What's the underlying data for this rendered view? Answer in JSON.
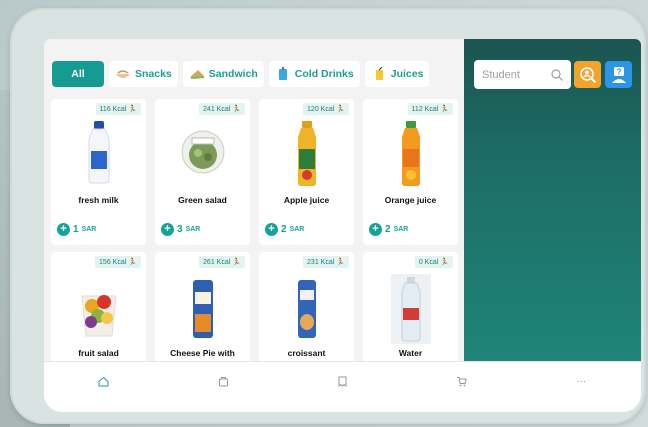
{
  "colors": {
    "accent": "#169b92",
    "panel": "#1d6b64",
    "orange": "#f1a32a",
    "blue": "#2d95e6"
  },
  "categories": [
    {
      "label": "All",
      "icon": "all",
      "active": true
    },
    {
      "label": "Snacks",
      "icon": "snacks-icon"
    },
    {
      "label": "Sandwich",
      "icon": "sandwich-icon"
    },
    {
      "label": "Cold Drinks",
      "icon": "cold-drink-icon"
    },
    {
      "label": "Juices",
      "icon": "juice-icon"
    }
  ],
  "search": {
    "placeholder": "Student"
  },
  "products": [
    {
      "name": "fresh milk",
      "kcal": "116 Kcal",
      "price": "1",
      "currency": "SAR",
      "image": "milk-bottle"
    },
    {
      "name": "Green salad",
      "kcal": "241 Kcal",
      "price": "3",
      "currency": "SAR",
      "image": "salad-bowl"
    },
    {
      "name": "Apple juice",
      "kcal": "120 Kcal",
      "price": "2",
      "currency": "SAR",
      "image": "apple-juice-bottle"
    },
    {
      "name": "Orange juice",
      "kcal": "112 Kcal",
      "price": "2",
      "currency": "SAR",
      "image": "orange-juice-bottle"
    },
    {
      "name": "fruit salad",
      "kcal": "156 Kcal",
      "image": "fruit-cup"
    },
    {
      "name": "Cheese Pie with",
      "kcal": "261 Kcal",
      "image": "pie-pack"
    },
    {
      "name": "croissant",
      "kcal": "231 Kcal",
      "image": "croissant-pack"
    },
    {
      "name": "Water",
      "kcal": "0 Kcal",
      "image": "water-bottle"
    }
  ],
  "nav": [
    {
      "icon": "home-icon"
    },
    {
      "icon": "orders-icon"
    },
    {
      "icon": "receipt-icon"
    },
    {
      "icon": "cart-icon"
    },
    {
      "icon": "more-icon",
      "glyph": "···"
    }
  ]
}
